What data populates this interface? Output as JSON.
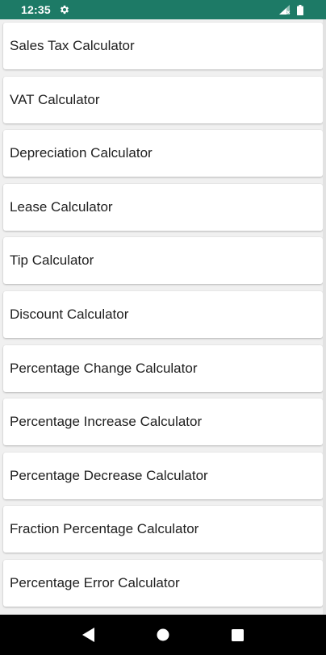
{
  "status_bar": {
    "time": "12:35",
    "icons": [
      "gear-icon",
      "signal-icon",
      "battery-icon"
    ],
    "background": "#1d7a66"
  },
  "list": {
    "items": [
      {
        "label": "Sales Tax Calculator"
      },
      {
        "label": "VAT Calculator"
      },
      {
        "label": "Depreciation Calculator"
      },
      {
        "label": "Lease Calculator"
      },
      {
        "label": "Tip Calculator"
      },
      {
        "label": "Discount Calculator"
      },
      {
        "label": "Percentage Change Calculator"
      },
      {
        "label": "Percentage Increase Calculator"
      },
      {
        "label": "Percentage Decrease Calculator"
      },
      {
        "label": "Fraction Percentage Calculator"
      },
      {
        "label": "Percentage Error Calculator"
      }
    ]
  },
  "nav_bar": {
    "icons": [
      "back-icon",
      "home-icon",
      "recents-icon"
    ]
  }
}
